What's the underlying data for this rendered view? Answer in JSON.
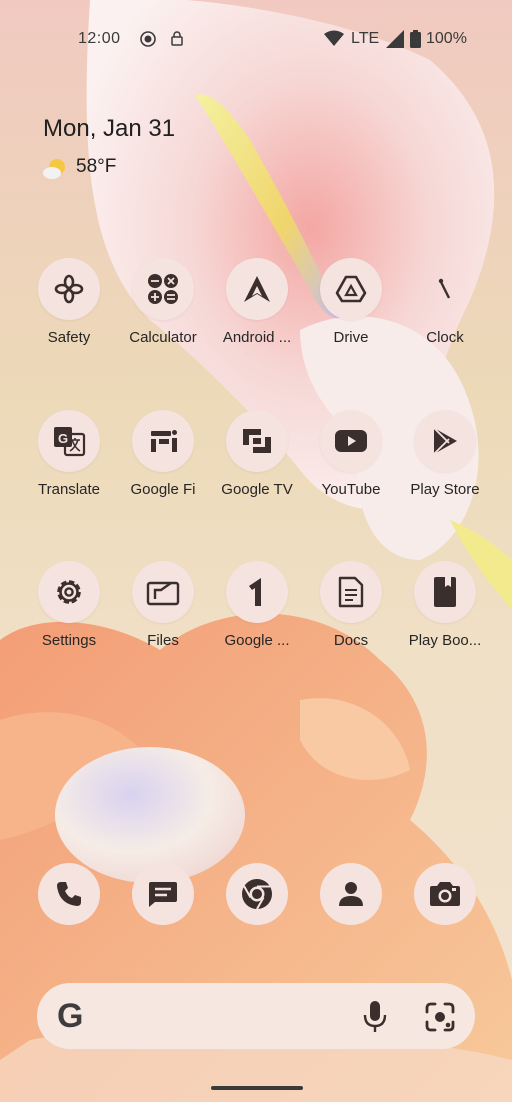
{
  "status_bar": {
    "time": "12:00",
    "network": "LTE",
    "battery": "100%",
    "icons": [
      "dnd-icon",
      "lock-icon",
      "wifi-icon",
      "signal-icon",
      "battery-icon"
    ]
  },
  "widget": {
    "date": "Mon, Jan 31",
    "temperature": "58°F",
    "weather_icon": "partly-sunny-icon"
  },
  "apps": [
    {
      "label": "Safety",
      "icon": "safety-icon"
    },
    {
      "label": "Calculator",
      "icon": "calculator-icon"
    },
    {
      "label": "Android ...",
      "icon": "android-auto-icon"
    },
    {
      "label": "Drive",
      "icon": "drive-icon"
    },
    {
      "label": "Clock",
      "icon": "clock-icon"
    },
    {
      "label": "Translate",
      "icon": "translate-icon"
    },
    {
      "label": "Google Fi",
      "icon": "google-fi-icon"
    },
    {
      "label": "Google TV",
      "icon": "google-tv-icon"
    },
    {
      "label": "YouTube",
      "icon": "youtube-icon"
    },
    {
      "label": "Play Store",
      "icon": "play-store-icon"
    },
    {
      "label": "Settings",
      "icon": "settings-icon"
    },
    {
      "label": "Files",
      "icon": "files-icon"
    },
    {
      "label": "Google ...",
      "icon": "google-one-icon"
    },
    {
      "label": "Docs",
      "icon": "docs-icon"
    },
    {
      "label": "Play Boo...",
      "icon": "play-books-icon"
    }
  ],
  "dock": [
    {
      "icon": "phone-icon"
    },
    {
      "icon": "messages-icon"
    },
    {
      "icon": "chrome-icon"
    },
    {
      "icon": "contacts-icon"
    },
    {
      "icon": "camera-icon"
    }
  ],
  "search_bar": {
    "logo": "G",
    "mic_icon": "microphone-icon",
    "lens_icon": "google-lens-icon"
  },
  "colors": {
    "icon_bg": "#f5e3df",
    "icon_fg": "#3b2f2d",
    "text": "#262626"
  }
}
